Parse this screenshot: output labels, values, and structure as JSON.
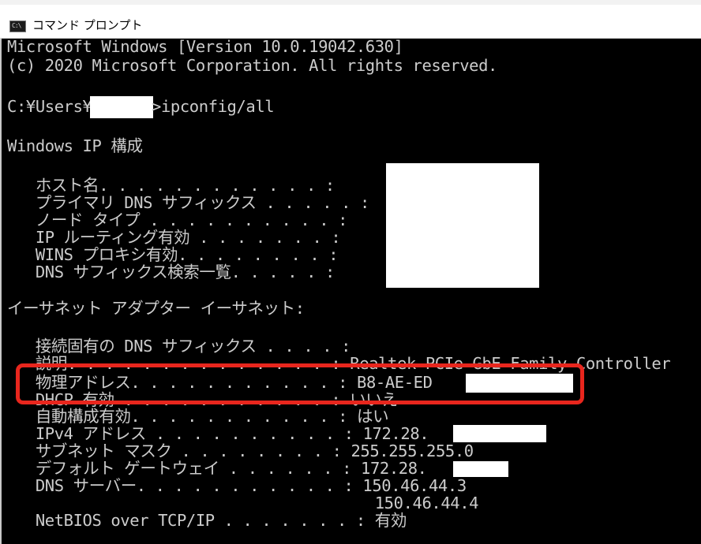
{
  "window": {
    "title": "コマンド プロンプト",
    "icon_label": "C:\\"
  },
  "console": {
    "lines": {
      "l1": "Microsoft Windows [Version 10.0.19042.630]",
      "l2": "(c) 2020 Microsoft Corporation. All rights reserved.",
      "l3a": "C:¥Users¥",
      "l3b": ">ipconfig/all",
      "l4": "Windows IP 構成",
      "l5": "   ホスト名. . . . . . . . . . . . :",
      "l6": "   プライマリ DNS サフィックス . . . . . :",
      "l7": "   ノード タイプ . . . . . . . . . . :",
      "l8": "   IP ルーティング有効 . . . . . . . :",
      "l9": "   WINS プロキシ有効. . . . . . . . :",
      "l10": "   DNS サフィックス検索一覧. . . . . :",
      "l11": "イーサネット アダプター イーサネット:",
      "l12": "   接続固有の DNS サフィックス . . . . :",
      "l13": "   説明. . . . . . . . . . . . . . : Realtek PCIe GbE Family Controller",
      "l14": "   物理アドレス. . . . . . . . . . . : B8-AE-ED",
      "l15": "   DHCP 有効 . . . . . . . . . . . : いいえ",
      "l16": "   自動構成有効. . . . . . . . . . . : はい",
      "l17": "   IPv4 アドレス . . . . . . . . . . : 172.28.",
      "l18": "   サブネット マスク . . . . . . . . : 255.255.255.0",
      "l19": "   デフォルト ゲートウェイ . . . . . . : 172.28.",
      "l20": "   DNS サーバー. . . . . . . . . . . : 150.46.44.3",
      "l21": "                                       150.46.44.4",
      "l22": "   NetBIOS over TCP/IP . . . . . . . : 有効"
    }
  },
  "colors": {
    "console_bg": "#000000",
    "console_text": "#cccccc",
    "highlight": "#e8261d",
    "redaction": "#ffffff"
  }
}
